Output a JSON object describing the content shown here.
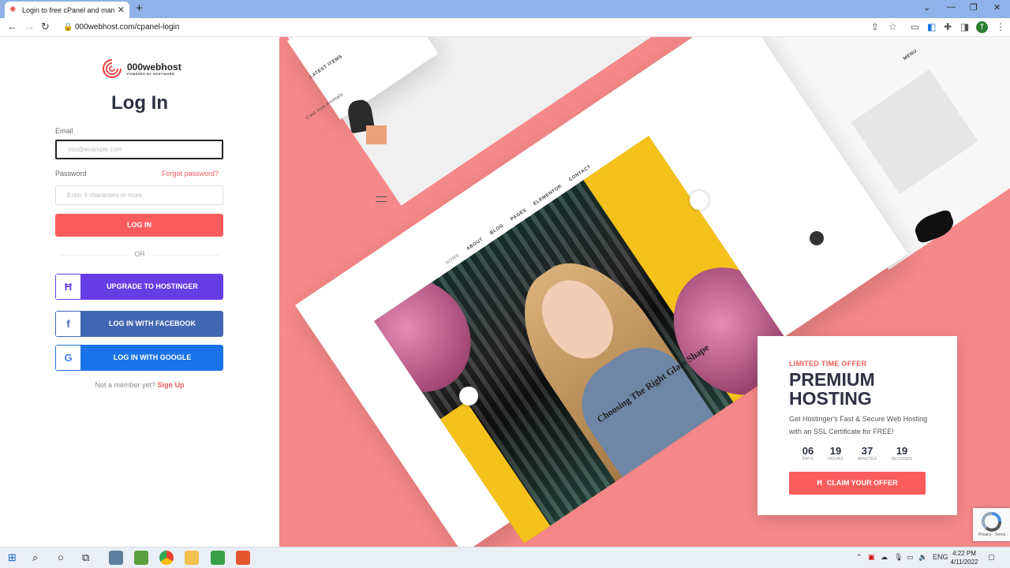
{
  "browser": {
    "tab_title": "Login to free cPanel and manage",
    "new_tab": "+",
    "url": "000webhost.com/cpanel-login",
    "profile_initial": "T"
  },
  "login": {
    "logo_name": "000webhost",
    "logo_sub": "POWERED BY HOSTINGER",
    "heading": "Log In",
    "email_label": "Email",
    "email_placeholder": "you@example.com",
    "password_label": "Password",
    "forgot": "Forgot password?",
    "password_placeholder": "Enter 6 characters or more",
    "login_button": "LOG IN",
    "or": "OR",
    "hostinger_button": "UPGRADE TO HOSTINGER",
    "facebook_button": "LOG IN WITH FACEBOOK",
    "google_button": "LOG IN WITH GOOGLE",
    "not_member": "Not a member yet?",
    "signup": "Sign Up",
    "colors": {
      "accent": "#fa5c5c",
      "hostinger": "#673de6",
      "facebook": "#4267b2",
      "google": "#1a73e8"
    }
  },
  "hero": {
    "nav_items": [
      "HOME",
      "ABOUT",
      "BLOG",
      "PAGES",
      "ELEMENTOR",
      "CONTACT"
    ],
    "post_title": "Choosing The Right Glass Shape",
    "latest_items": "LATEST ITEMS",
    "cast_iron": "Cast Iron Animals",
    "menu": "MENU"
  },
  "offer": {
    "tag": "LIMITED TIME OFFER",
    "title_line1": "PREMIUM",
    "title_line2": "HOSTING",
    "description": "Get Hostinger's Fast & Secure Web Hosting with an SSL Certificate for FREE!",
    "countdown": [
      {
        "value": "06",
        "unit": "DAYS"
      },
      {
        "value": "19",
        "unit": "HOURS"
      },
      {
        "value": "37",
        "unit": "MINUTES"
      },
      {
        "value": "19",
        "unit": "SECONDS"
      }
    ],
    "claim": "CLAIM YOUR OFFER"
  },
  "recaptcha": {
    "text": "Privacy - Terms"
  },
  "taskbar": {
    "lang": "ENG",
    "time": "4:22 PM",
    "date": "4/11/2022"
  }
}
